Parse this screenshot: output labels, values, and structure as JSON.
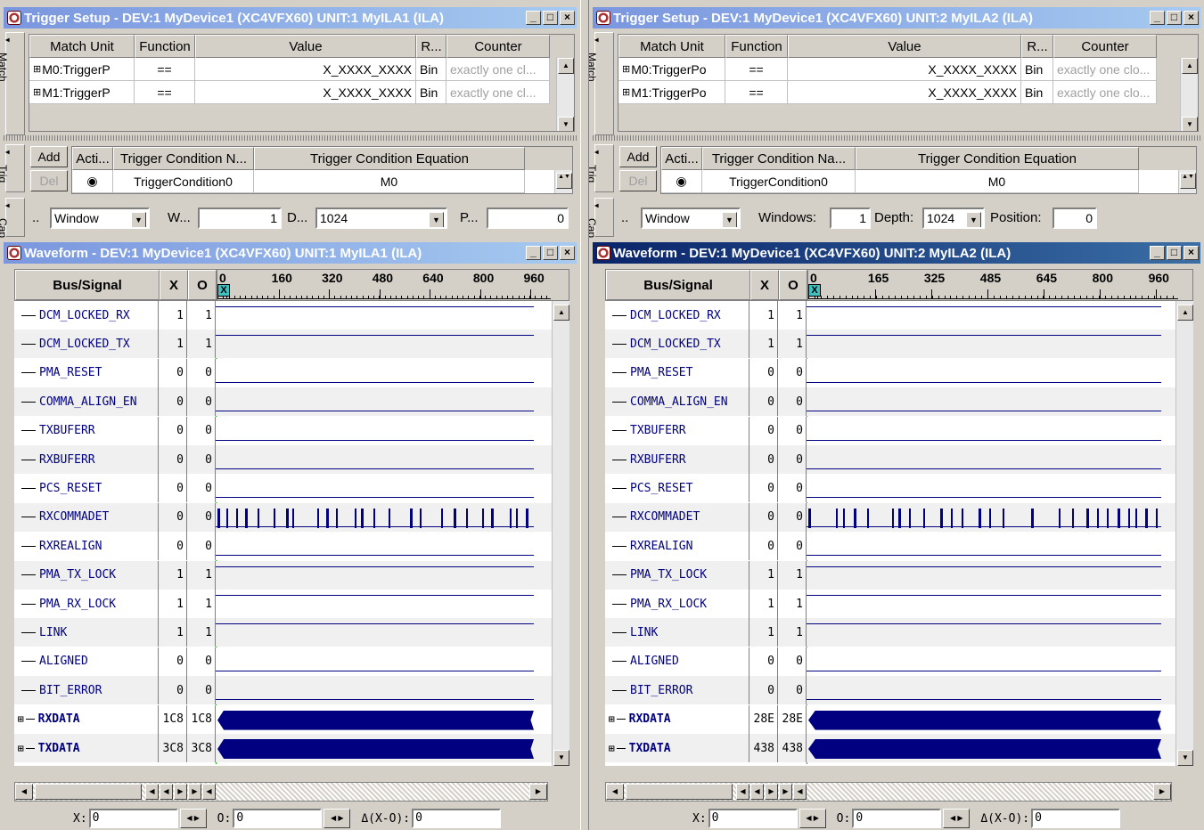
{
  "panes": [
    {
      "trigger_title": "Trigger Setup - DEV:1 MyDevice1 (XC4VFX60) UNIT:1 MyILA1 (ILA)",
      "waveform_title": "Waveform - DEV:1 MyDevice1 (XC4VFX60) UNIT:1 MyILA1 (ILA)",
      "trigger_active": false,
      "waveform_active": false,
      "match": {
        "headers": [
          "Match Unit",
          "Function",
          "Value",
          "R...",
          "Counter"
        ],
        "rows": [
          [
            "M0:TriggerP",
            "==",
            "X_XXXX_XXXX",
            "Bin",
            "exactly one cl..."
          ],
          [
            "M1:TriggerP",
            "==",
            "X_XXXX_XXXX",
            "Bin",
            "exactly one cl..."
          ]
        ]
      },
      "trig": {
        "add": "Add",
        "del": "Del",
        "headers": [
          "Acti...",
          "Trigger Condition N...",
          "Trigger Condition Equation"
        ],
        "row": [
          "◉",
          "TriggerCondition0",
          "M0"
        ]
      },
      "cap": {
        "dots": "..",
        "mode": "Window",
        "windows_label": "W...",
        "windows": "1",
        "depth_label": "D...",
        "depth": "1024",
        "position_label": "P...",
        "position": "0"
      },
      "ruler": [
        "0",
        "160",
        "320",
        "480",
        "640",
        "800",
        "960"
      ],
      "values": [
        [
          "1",
          "1"
        ],
        [
          "1",
          "1"
        ],
        [
          "0",
          "0"
        ],
        [
          "0",
          "0"
        ],
        [
          "0",
          "0"
        ],
        [
          "0",
          "0"
        ],
        [
          "0",
          "0"
        ],
        [
          "0",
          "0"
        ],
        [
          "0",
          "0"
        ],
        [
          "1",
          "1"
        ],
        [
          "1",
          "1"
        ],
        [
          "1",
          "1"
        ],
        [
          "0",
          "0"
        ],
        [
          "0",
          "0"
        ],
        [
          "1C8",
          "1C8"
        ],
        [
          "3C8",
          "3C8"
        ]
      ],
      "cursor": {
        "x_label": "X:",
        "x": "0",
        "o_label": "O:",
        "o": "0",
        "d_label": "Δ(X-O):",
        "d": "0"
      }
    },
    {
      "trigger_title": "Trigger Setup - DEV:1 MyDevice1 (XC4VFX60) UNIT:2 MyILA2 (ILA)",
      "waveform_title": "Waveform - DEV:1 MyDevice1 (XC4VFX60) UNIT:2 MyILA2 (ILA)",
      "trigger_active": false,
      "waveform_active": true,
      "match": {
        "headers": [
          "Match Unit",
          "Function",
          "Value",
          "R...",
          "Counter"
        ],
        "rows": [
          [
            "M0:TriggerPo",
            "==",
            "X_XXXX_XXXX",
            "Bin",
            "exactly one clo..."
          ],
          [
            "M1:TriggerPo",
            "==",
            "X_XXXX_XXXX",
            "Bin",
            "exactly one clo..."
          ]
        ]
      },
      "trig": {
        "add": "Add",
        "del": "Del",
        "headers": [
          "Acti...",
          "Trigger Condition Na...",
          "Trigger Condition Equation"
        ],
        "row": [
          "◉",
          "TriggerCondition0",
          "M0"
        ]
      },
      "cap": {
        "dots": "..",
        "mode": "Window",
        "windows_label": "Windows:",
        "windows": "1",
        "depth_label": "Depth:",
        "depth": "1024",
        "position_label": "Position:",
        "position": "0"
      },
      "ruler": [
        "0",
        "165",
        "325",
        "485",
        "645",
        "800",
        "960"
      ],
      "values": [
        [
          "1",
          "1"
        ],
        [
          "1",
          "1"
        ],
        [
          "0",
          "0"
        ],
        [
          "0",
          "0"
        ],
        [
          "0",
          "0"
        ],
        [
          "0",
          "0"
        ],
        [
          "0",
          "0"
        ],
        [
          "0",
          "0"
        ],
        [
          "0",
          "0"
        ],
        [
          "1",
          "1"
        ],
        [
          "1",
          "1"
        ],
        [
          "1",
          "1"
        ],
        [
          "0",
          "0"
        ],
        [
          "0",
          "0"
        ],
        [
          "28E",
          "28E"
        ],
        [
          "438",
          "438"
        ]
      ],
      "cursor": {
        "x_label": "X:",
        "x": "0",
        "o_label": "O:",
        "o": "0",
        "d_label": "Δ(X-O):",
        "d": "0"
      }
    }
  ],
  "signals": [
    "DCM_LOCKED_RX",
    "DCM_LOCKED_TX",
    "PMA_RESET",
    "COMMA_ALIGN_EN",
    "TXBUFERR",
    "RXBUFERR",
    "PCS_RESET",
    "RXCOMMADET",
    "RXREALIGN",
    "PMA_TX_LOCK",
    "PMA_RX_LOCK",
    "LINK",
    "ALIGNED",
    "BIT_ERROR",
    "RXDATA",
    "TXDATA"
  ],
  "bus_signals": [
    "RXDATA",
    "TXDATA"
  ],
  "labels": {
    "bus_signal": "Bus/Signal",
    "x_col": "X",
    "o_col": "O",
    "cursor_tag": "X",
    "match_tab": "Match",
    "trig_tab": "Trig",
    "cap_tab": "Cap"
  },
  "colors": {
    "trace": "#000080",
    "cursor": "#00c000",
    "active_title": "#0a246a",
    "inactive_title": "#7a96df"
  }
}
